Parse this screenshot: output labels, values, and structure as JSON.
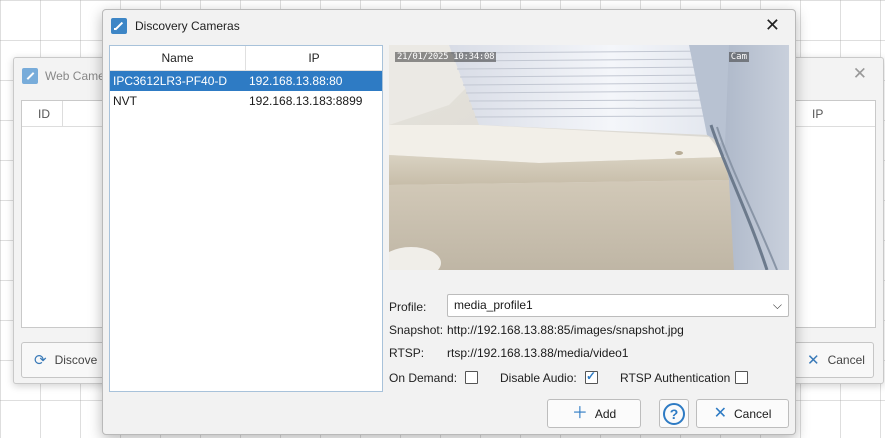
{
  "back_window": {
    "title": "Web Came",
    "col_id": "ID",
    "col_ip": "IP",
    "discover_label": "Discove",
    "cancel_label": "Cancel"
  },
  "dialog": {
    "title": "Discovery Cameras",
    "list": {
      "columns": [
        "Name",
        "IP"
      ],
      "rows": [
        {
          "name": "IPC3612LR3-PF40-D",
          "ip": "192.168.13.88:80",
          "selected": true
        },
        {
          "name": "NVT",
          "ip": "192.168.13.183:8899",
          "selected": false
        }
      ]
    },
    "preview": {
      "timestamp": "21/01/2025 10:34:08",
      "channel": "Cam"
    },
    "form": {
      "profile_label": "Profile:",
      "profile_value": "media_profile1",
      "snapshot_label": "Snapshot:",
      "snapshot_value": "http://192.168.13.88:85/images/snapshot.jpg",
      "rtsp_label": "RTSP:",
      "rtsp_value": "rtsp://192.168.13.88/media/video1",
      "on_demand_label": "On Demand:",
      "on_demand_checked": false,
      "disable_audio_label": "Disable Audio:",
      "disable_audio_checked": true,
      "rtsp_auth_label": "RTSP Authentication",
      "rtsp_auth_checked": false
    },
    "buttons": {
      "add_label": "Add",
      "help_label": "?",
      "cancel_label": "Cancel"
    }
  },
  "colors": {
    "accent": "#2e7bc4",
    "selection": "#2e7bc4"
  }
}
